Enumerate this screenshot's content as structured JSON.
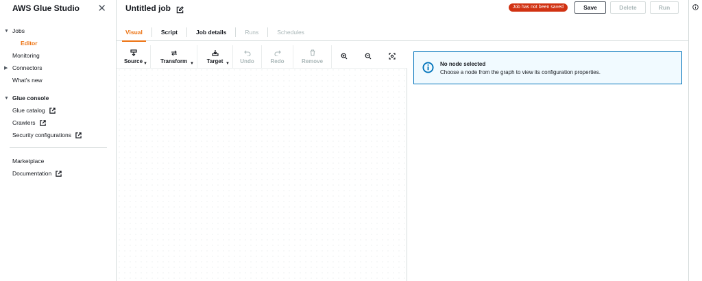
{
  "sidebar": {
    "title": "AWS Glue Studio",
    "items": [
      {
        "label": "Jobs"
      },
      {
        "label": "Editor"
      },
      {
        "label": "Monitoring"
      },
      {
        "label": "Connectors"
      },
      {
        "label": "What's new"
      }
    ],
    "glue_console": {
      "label": "Glue console",
      "items": [
        {
          "label": "Glue catalog"
        },
        {
          "label": "Crawlers"
        },
        {
          "label": "Security configurations"
        }
      ]
    },
    "footer_items": [
      {
        "label": "Marketplace"
      },
      {
        "label": "Documentation"
      }
    ]
  },
  "header": {
    "job_title": "Untitled job",
    "badge": "Job has not been saved",
    "save_label": "Save",
    "delete_label": "Delete",
    "run_label": "Run"
  },
  "tabs": [
    {
      "label": "Visual"
    },
    {
      "label": "Script"
    },
    {
      "label": "Job details"
    },
    {
      "label": "Runs"
    },
    {
      "label": "Schedules"
    }
  ],
  "toolbar": {
    "source": "Source",
    "transform": "Transform",
    "target": "Target",
    "undo": "Undo",
    "redo": "Redo",
    "remove": "Remove"
  },
  "panel": {
    "alert_title": "No node selected",
    "alert_desc": "Choose a node from the graph to view its configuration properties."
  },
  "colors": {
    "accent": "#ec7211",
    "info": "#0073bb",
    "badge": "#d13212"
  }
}
